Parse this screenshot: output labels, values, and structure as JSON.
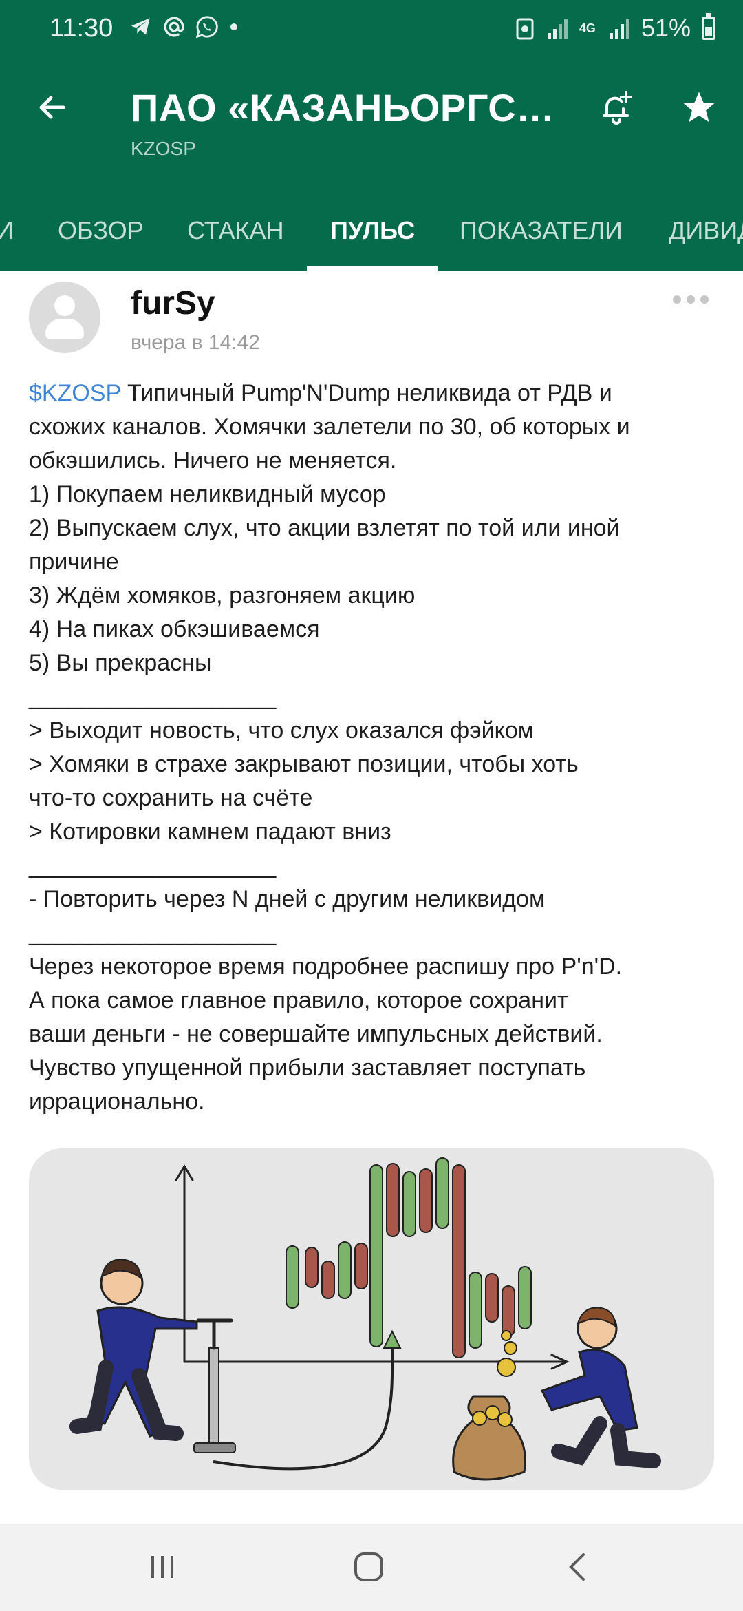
{
  "status_bar": {
    "time": "11:30",
    "battery": "51%",
    "network": "4G"
  },
  "header": {
    "title": "ПАО «КАЗАНЬОРГСИНТ…",
    "ticker": "KZOSP",
    "bg_color": "#066b4b"
  },
  "tabs": [
    {
      "label": "И"
    },
    {
      "label": "ОБЗОР"
    },
    {
      "label": "СТАКАН"
    },
    {
      "label": "ПУЛЬС",
      "active": true
    },
    {
      "label": "ПОКАЗАТЕЛИ"
    },
    {
      "label": "ДИВИДЕНДЫ"
    }
  ],
  "post": {
    "author": "furSy",
    "time": "вчера в 14:42",
    "ticker_link": "$KZOSP",
    "lines": [
      " Типичный Pump'N'Dump неликвида от РДВ и",
      "схожих каналов. Хомячки залетели по 30, об которых и",
      "обкэшились. Ничего не меняется.",
      "1) Покупаем неликвидный мусор",
      "2) Выпускаем слух, что акции взлетят по той или иной",
      "причине",
      "3) Ждём хомяков, разгоняем акцию",
      "4) На пиках обкэшиваемся",
      "5) Вы прекрасны",
      "___________________",
      "> Выходит новость, что слух оказался фэйком",
      "> Хомяки в страхе закрывают позиции, чтобы хоть",
      "что-то сохранить на счёте",
      "> Котировки камнем падают вниз",
      "___________________",
      "- Повторить через N дней с другим неликвидом",
      "___________________",
      "Через некоторое время подробнее распишу про P'n'D.",
      "А пока самое главное правило, которое сохранит",
      "ваши деньги - не совершайте импульсных действий.",
      "Чувство упущенной прибыли заставляет поступать",
      "иррационально."
    ],
    "link_color": "#3f84d6"
  },
  "illustration": {
    "candle_up_color": "#7db36a",
    "candle_down_color": "#a9574a"
  }
}
